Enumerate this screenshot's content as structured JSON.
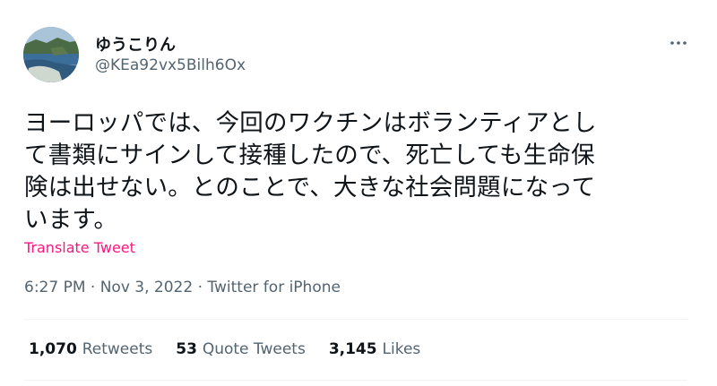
{
  "author": {
    "display_name": "ゆうこりん",
    "handle": "@KEa92vx5Bilh6Ox"
  },
  "tweet": {
    "lines": [
      "ヨーロッパでは、今回のワクチンはボランティアとし",
      "て書類にサインして接種したので、死亡しても生命保",
      "険は出せない。とのことで、大きな社会問題になって",
      "います。"
    ],
    "translate_label": "Translate Tweet",
    "time": "6:27 PM",
    "separator": "·",
    "date": "Nov 3, 2022",
    "source": "Twitter for iPhone"
  },
  "stats": {
    "retweets_count": "1,070",
    "retweets_label": "Retweets",
    "quotes_count": "53",
    "quotes_label": "Quote Tweets",
    "likes_count": "3,145",
    "likes_label": "Likes"
  },
  "icons": {
    "more": "more-horizontal-icon"
  },
  "colors": {
    "text": "#0f1419",
    "secondary": "#536471",
    "translate": "#f91880",
    "divider": "#eff3f4"
  }
}
